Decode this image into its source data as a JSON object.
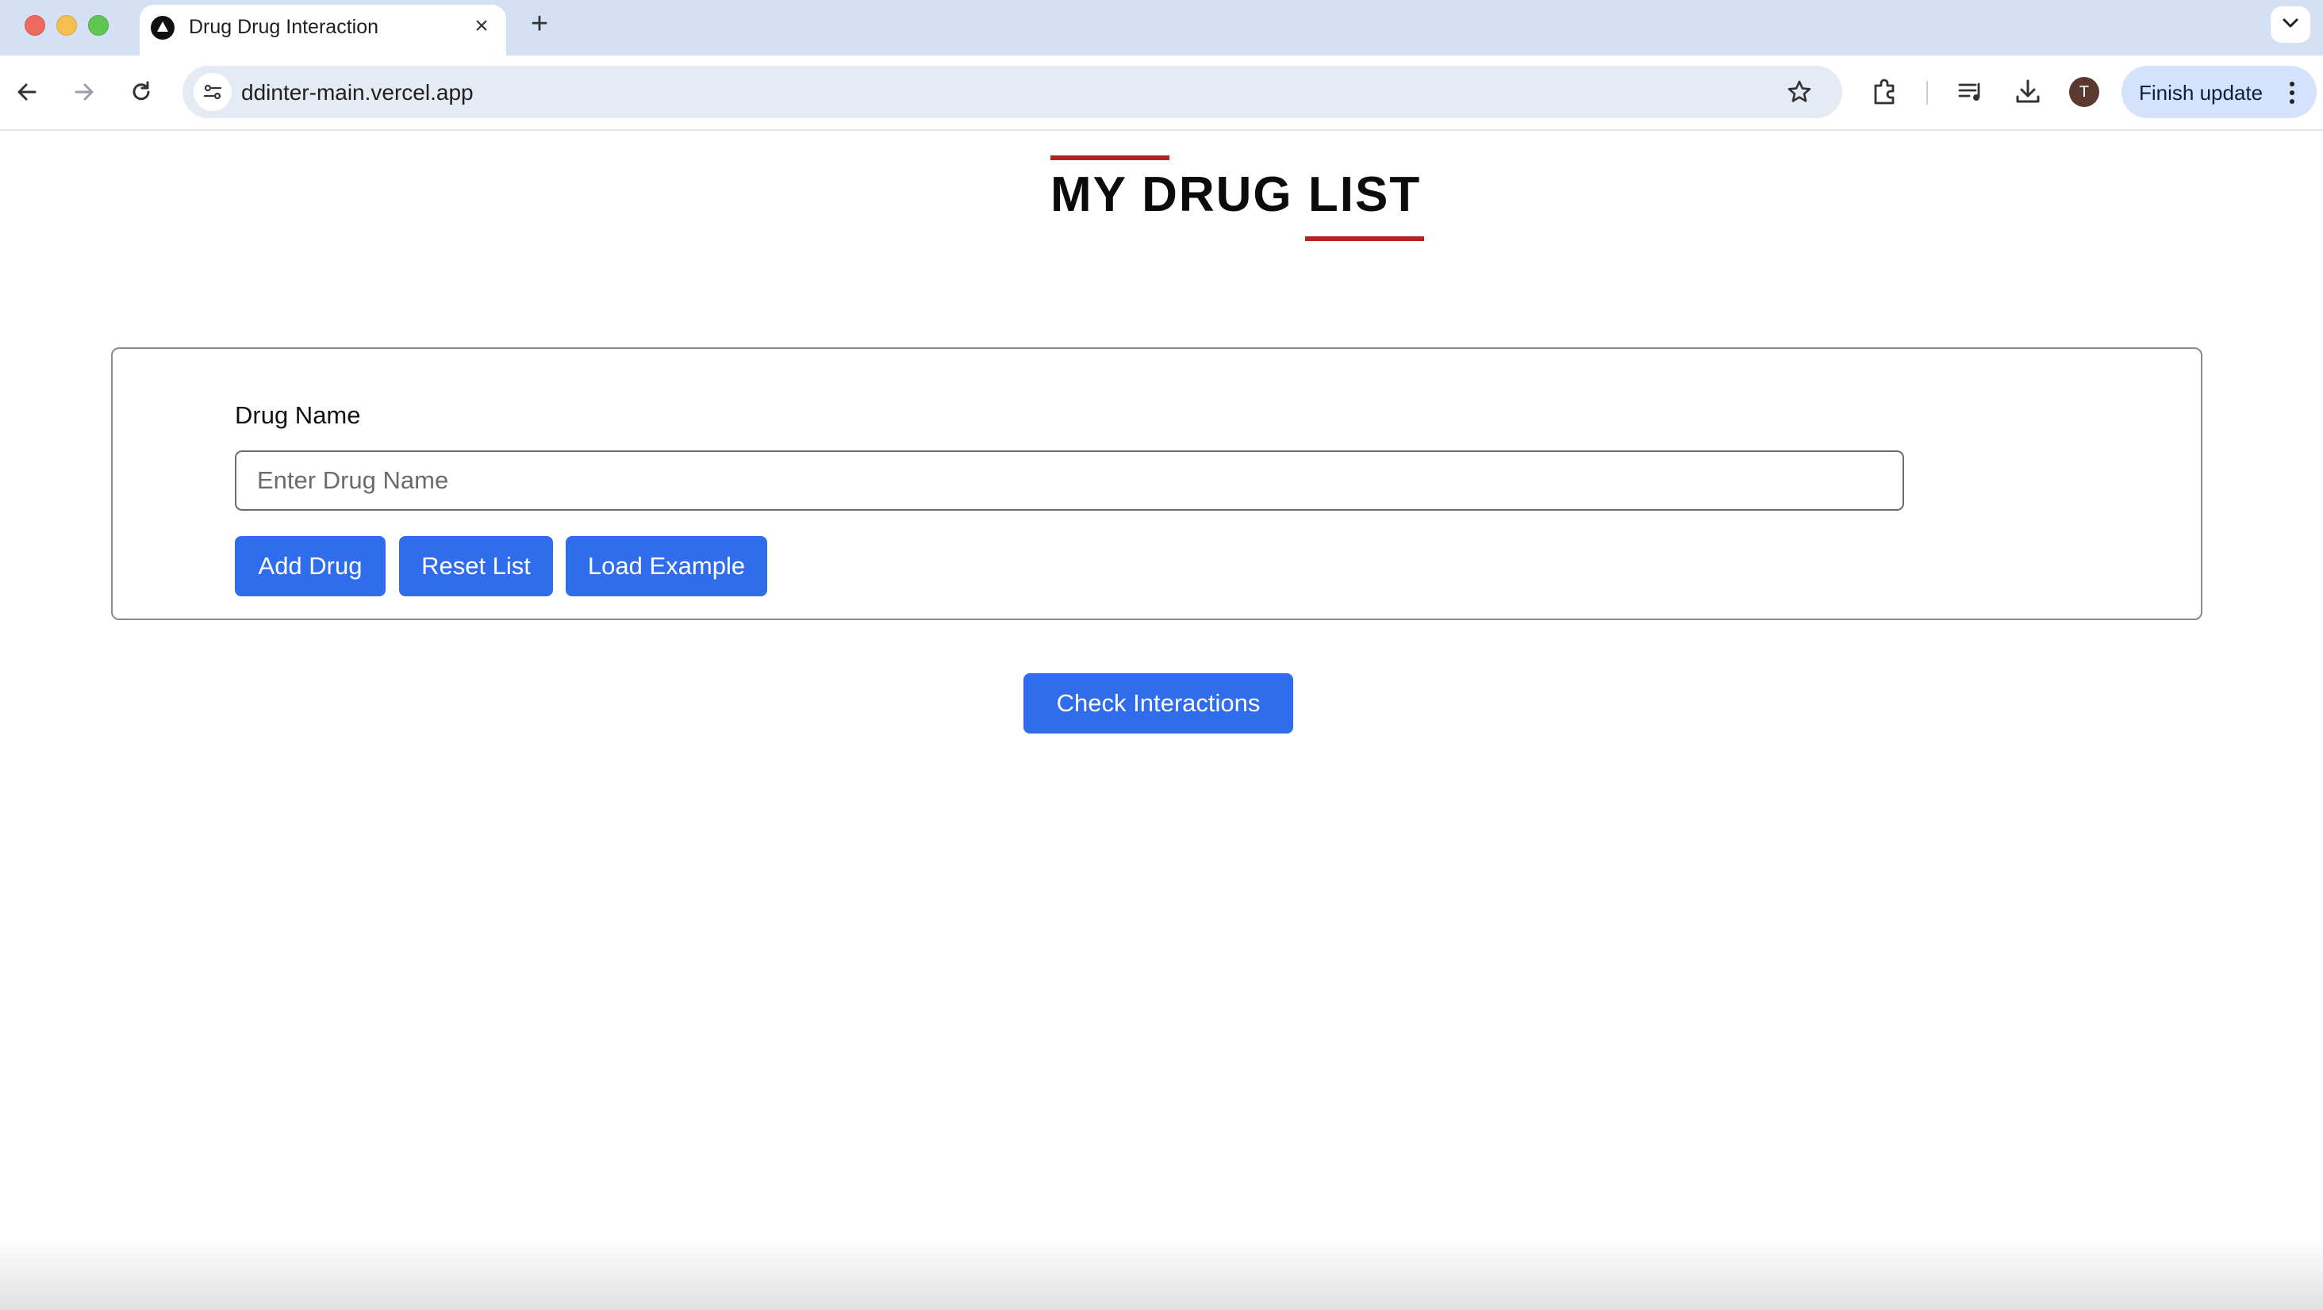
{
  "browser": {
    "tab": {
      "title": "Drug Drug Interaction",
      "favicon": "triangle-logo-icon",
      "close_icon": "close-icon"
    },
    "new_tab_icon": "plus-icon",
    "tab_menu_icon": "chevron-down-icon",
    "url": "ddinter-main.vercel.app",
    "avatar_initial": "T",
    "finish_update_label": "Finish update"
  },
  "page": {
    "title": "MY DRUG LIST",
    "accent_color": "#b32424",
    "form": {
      "label": "Drug Name",
      "input_value": "",
      "input_placeholder": "Enter Drug Name",
      "buttons": {
        "add": "Add Drug",
        "reset": "Reset List",
        "example": "Load Example"
      }
    },
    "check_button": "Check Interactions",
    "button_color": "#2f6ded"
  }
}
